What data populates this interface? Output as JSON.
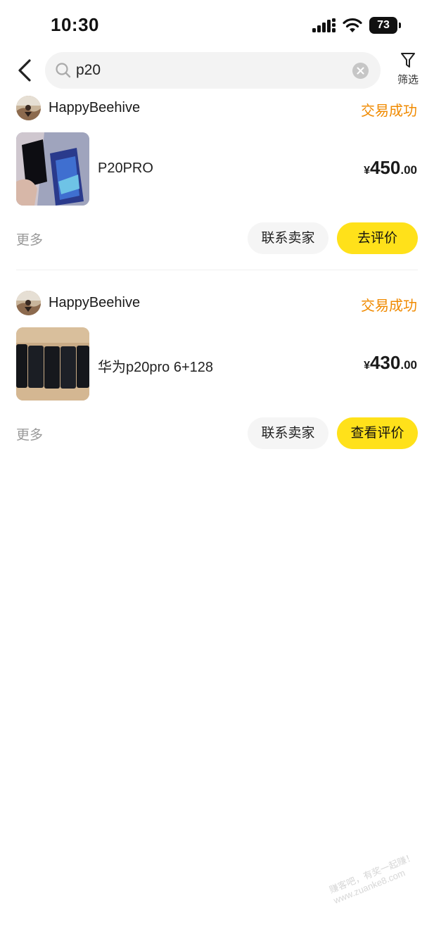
{
  "status_bar": {
    "time": "10:30",
    "battery_level": "73"
  },
  "search": {
    "query": "p20",
    "filter_label": "筛选"
  },
  "orders": [
    {
      "seller": "HappyBeehive",
      "status": "交易成功",
      "title": "P20PRO",
      "price_symbol": "¥",
      "price_int": "450",
      "price_dec": ".00",
      "more": "更多",
      "contact_label": "联系卖家",
      "action_label": "去评价"
    },
    {
      "seller": "HappyBeehive",
      "status": "交易成功",
      "title": "华为p20pro 6+128",
      "price_symbol": "¥",
      "price_int": "430",
      "price_dec": ".00",
      "more": "更多",
      "contact_label": "联系卖家",
      "action_label": "查看评价"
    }
  ],
  "watermark": {
    "line1": "赚客吧，有奖一起赚！",
    "line2": "www.zuanke8.com"
  },
  "colors": {
    "accent_yellow": "#ffe11a",
    "status_orange": "#f08a00",
    "search_bg": "#f3f3f3"
  }
}
